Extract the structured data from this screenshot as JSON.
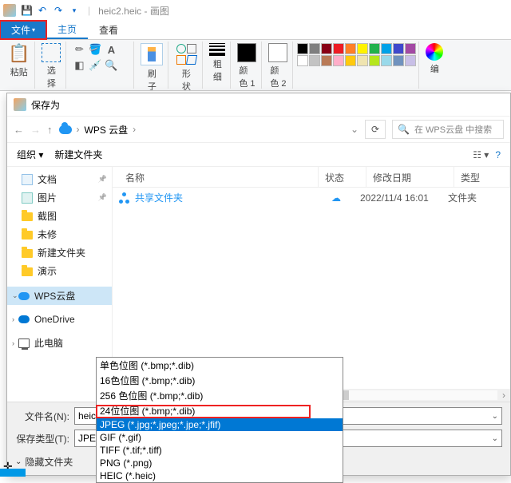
{
  "title": {
    "doc": "heic2.heic",
    "app": "画图"
  },
  "tabs": {
    "file": "文件",
    "home": "主页",
    "view": "查看"
  },
  "ribbon": {
    "paste": "粘贴",
    "select": "选\n择",
    "brushes": "刷\n子",
    "shapes": "形\n状",
    "thickness": "粗\n细",
    "color1": "颜\n色 1",
    "color2": "颜\n色 2",
    "edit": "编"
  },
  "dialog": {
    "title": "保存为",
    "location": "WPS 云盘",
    "search_placeholder": "在 WPS云盘 中搜索",
    "organize": "组织",
    "new_folder": "新建文件夹",
    "cols": {
      "name": "名称",
      "status": "状态",
      "date": "修改日期",
      "type": "类型"
    },
    "row": {
      "name": "共享文件夹",
      "status": "☁",
      "date": "2022/11/4 16:01",
      "type": "文件夹"
    },
    "filename_label": "文件名(N):",
    "filename_value": "heic2.jpg",
    "savetype_label": "保存类型(T):",
    "savetype_value": "JPEG (*.jpg;*.jpeg;*.jpe;*.jfif)",
    "hide_folders": "隐藏文件夹"
  },
  "tree": {
    "docs": "文档",
    "pics": "图片",
    "screenshot": "截图",
    "untitled": "未修",
    "newfolder": "新建文件夹",
    "demo": "演示",
    "wps": "WPS云盘",
    "onedrive": "OneDrive",
    "thispc": "此电脑"
  },
  "formats": {
    "bmp1": "单色位图 (*.bmp;*.dib)",
    "bmp16": "16色位图 (*.bmp;*.dib)",
    "bmp256": "256 色位图 (*.bmp;*.dib)",
    "bmp24": "24位位图 (*.bmp;*.dib)",
    "jpeg": "JPEG (*.jpg;*.jpeg;*.jpe;*.jfif)",
    "gif": "GIF (*.gif)",
    "tiff": "TIFF (*.tif;*.tiff)",
    "png": "PNG (*.png)",
    "heic": "HEIC (*.heic)"
  },
  "palette": [
    "#000",
    "#7f7f7f",
    "#880015",
    "#ed1c24",
    "#ff7f27",
    "#fff200",
    "#22b14c",
    "#00a2e8",
    "#3f48cc",
    "#a349a4",
    "#fff",
    "#c3c3c3",
    "#b97a57",
    "#ffaec9",
    "#ffc90e",
    "#efe4b0",
    "#b5e61d",
    "#99d9ea",
    "#7092be",
    "#c8bfe7"
  ]
}
